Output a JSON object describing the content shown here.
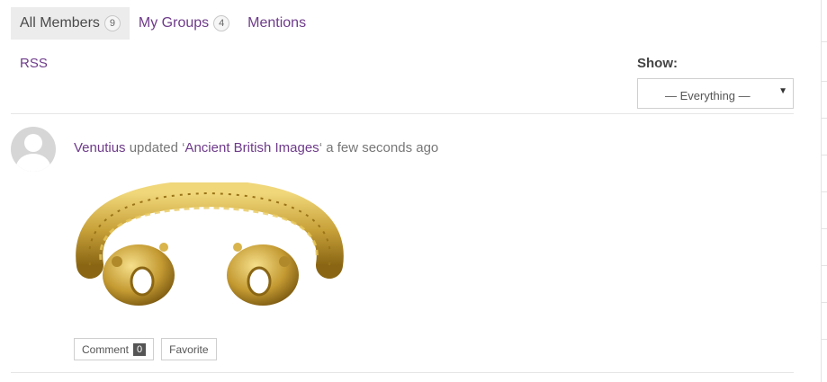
{
  "tabs": [
    {
      "label": "All Members",
      "count": "9"
    },
    {
      "label": "My Groups",
      "count": "4"
    },
    {
      "label": "Mentions"
    }
  ],
  "rss_label": "RSS",
  "filter": {
    "label": "Show:",
    "selected": "— Everything —"
  },
  "activity": {
    "user": "Venutius",
    "verb": "updated ‘",
    "target": "Ancient British Images",
    "time": "‘ a few seconds ago",
    "image_icon": "gold-torc-image"
  },
  "actions": {
    "comment_label": "Comment",
    "comment_count": "0",
    "favorite_label": "Favorite"
  },
  "colors": {
    "link": "#6e3b8a",
    "active_tab_bg": "#ececec",
    "gold": "#c9a23a"
  }
}
